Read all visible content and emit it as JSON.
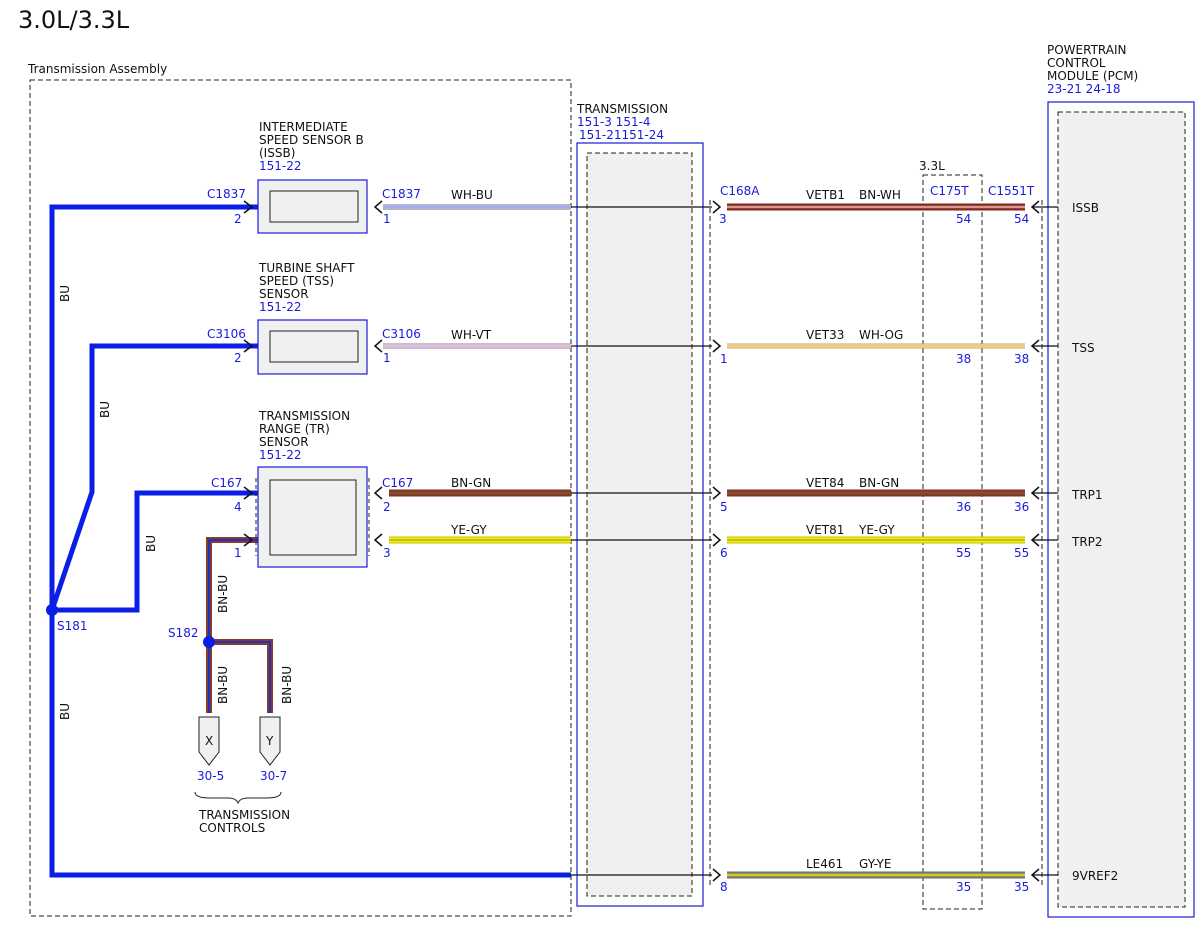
{
  "title": "3.0L/3.3L",
  "colors": {
    "bu": "#0a1ee6",
    "ref_blue": "#1a1adc",
    "box_fill": "#f0f0f0",
    "wire_bn": "#8b3a2a",
    "wire_red": "#c0392b",
    "wire_ye": "#e8e000",
    "wire_wh": "#ffffff",
    "wire_gy": "#8c8c8c",
    "wire_vt": "#c080c0",
    "wire_og": "#f0a000",
    "wire_gn": "#2e8b2e"
  },
  "transmission_assembly": {
    "label": "Transmission Assembly"
  },
  "transmission_block": {
    "name": "TRANSMISSION",
    "ref1": "151-3 151-4",
    "ref2": "151-21151-24"
  },
  "pcm": {
    "name_line1": "POWERTRAIN",
    "name_line2": "CONTROL",
    "name_line3": "MODULE (PCM)",
    "ref": "23-21 24-18",
    "pins": [
      "ISSB",
      "TSS",
      "TRP1",
      "TRP2",
      "9VREF2"
    ]
  },
  "inline_3_3l": {
    "label": "3.3L"
  },
  "sensors": {
    "issb": {
      "line1": "INTERMEDIATE",
      "line2": "SPEED SENSOR B",
      "line3": "(ISSB)",
      "ref": "151-22"
    },
    "tss": {
      "line1": "TURBINE SHAFT",
      "line2": "SPEED (TSS)",
      "line3": "SENSOR",
      "ref": "151-22"
    },
    "tr": {
      "line1": "TRANSMISSION",
      "line2": "RANGE (TR)",
      "line3": "SENSOR",
      "ref": "151-22"
    }
  },
  "connectors": {
    "c1837": "C1837",
    "c3106": "C3106",
    "c167": "C167",
    "c168a": "C168A",
    "c175t": "C175T",
    "c1551t": "C1551T"
  },
  "pins": {
    "issb_left": "2",
    "issb_right": "1",
    "tss_left": "2",
    "tss_right": "1",
    "tr_left_4": "4",
    "tr_left_1": "1",
    "tr_right_2": "2",
    "tr_right_3": "3",
    "c168a": [
      "3",
      "1",
      "5",
      "6",
      "8"
    ],
    "c175t": [
      "54",
      "38",
      "36",
      "55",
      "35"
    ],
    "c1551t": [
      "54",
      "38",
      "36",
      "55",
      "35"
    ]
  },
  "wires": {
    "issb_in": "WH-BU",
    "tss_in": "WH-VT",
    "trp1_in": "BN-GN",
    "trp2_in": "YE-GY",
    "issb_circuit": "VETB1",
    "issb_color": "BN-WH",
    "tss_circuit": "VET33",
    "tss_color": "WH-OG",
    "trp1_circuit": "VET84",
    "trp1_color": "BN-GN",
    "trp2_circuit": "VET81",
    "trp2_color": "YE-GY",
    "vref_circuit": "LE461",
    "vref_color": "GY-YE",
    "bu_a": "BU",
    "bu_b": "BU",
    "bu_c": "BU",
    "bu_d": "BU",
    "bnbu_a": "BN-BU",
    "bnbu_b": "BN-BU",
    "bnbu_c": "BN-BU"
  },
  "splices": {
    "s181": "S181",
    "s182": "S182"
  },
  "terminals": {
    "x": {
      "letter": "X",
      "ref": "30-5"
    },
    "y": {
      "letter": "Y",
      "ref": "30-7"
    },
    "group_line1": "TRANSMISSION",
    "group_line2": "CONTROLS"
  }
}
